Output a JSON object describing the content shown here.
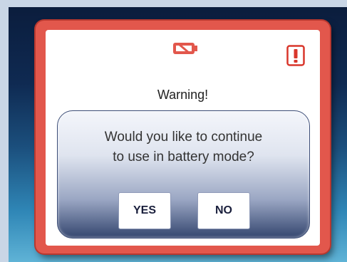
{
  "dialog": {
    "title": "Warning!",
    "message_line1": "Would you like to continue",
    "message_line2": "to use in battery mode?",
    "yes_label": "YES",
    "no_label": "NO",
    "battery_icon": "battery-empty-icon",
    "alert_icon": "exclamation-icon"
  },
  "colors": {
    "frame_red": "#e2574c",
    "panel_navy": "#34466f",
    "background_dark": "#0b1d3d",
    "background_light": "#5fb3d6"
  }
}
